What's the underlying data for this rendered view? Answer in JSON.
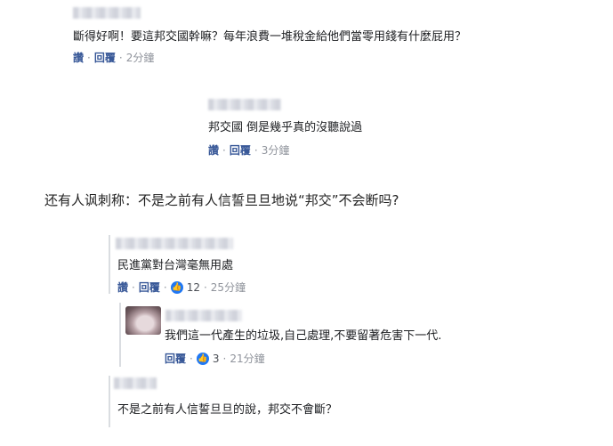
{
  "comments": [
    {
      "text": "斷得好啊！要這邦交國幹嘛？每年浪費一堆稅金給他們當零用錢有什麼屁用？",
      "actions": {
        "read": "讚",
        "reply": "回覆",
        "time": "2分鐘"
      }
    },
    {
      "text": "邦交國 倒是幾乎真的沒聽說過",
      "actions": {
        "read": "讚",
        "reply": "回覆",
        "time": "3分鐘"
      }
    }
  ],
  "narration": "还有人讽刺称：不是之前有人信誓旦旦地说“邦交”不会断吗?",
  "thread": {
    "main": {
      "text": "民進黨對台灣毫無用處",
      "actions": {
        "read": "讚",
        "reply": "回覆",
        "likes": "12",
        "time": "25分鐘"
      }
    },
    "reply": {
      "text": "我們這一代產生的垃圾,自己處理,不要留著危害下一代.",
      "actions": {
        "reply": "回覆",
        "likes": "3",
        "time": "21分鐘"
      }
    },
    "last": {
      "text": "不是之前有人信誓旦旦的說，邦交不會斷？"
    }
  },
  "separator": "·",
  "like_icon": "thumbs-up-icon",
  "colors": {
    "link": "#385898",
    "meta": "#90949c",
    "like": "#2078f4"
  }
}
